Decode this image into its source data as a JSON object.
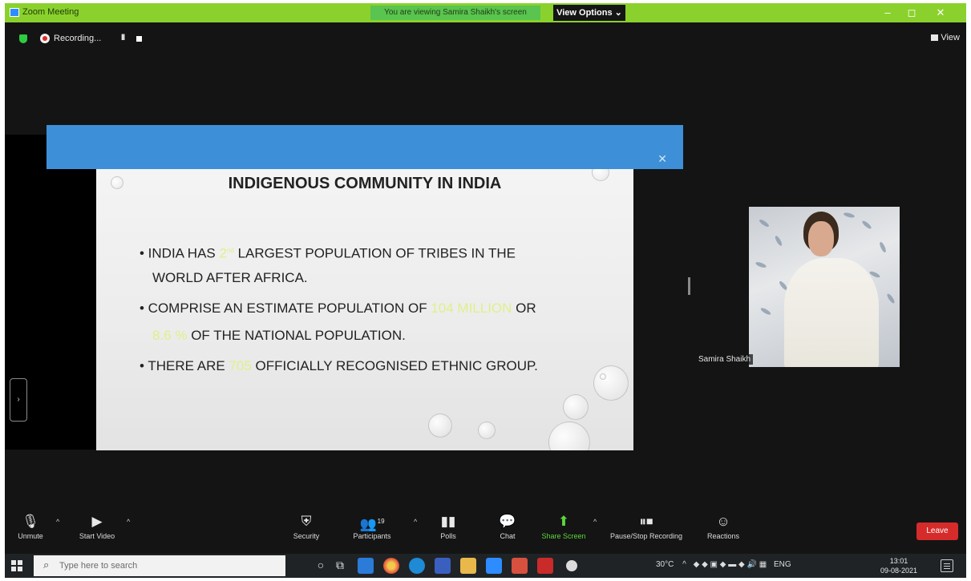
{
  "window": {
    "title": "Zoom Meeting",
    "share_banner": "You are viewing Samira Shaikh's screen",
    "view_options": "View Options",
    "view_options_caret": "⌄",
    "minimize": "–",
    "maximize": "◻",
    "close": "✕"
  },
  "recording": {
    "label": "Recording...",
    "pause_glyph": "II",
    "view_label": "View"
  },
  "slide": {
    "title": "INDIGENOUS COMMUNITY IN INDIA",
    "bullet1": {
      "prefix": "• INDIA HAS ",
      "highlight": "2",
      "superscript": "nd",
      "suffix": "  LARGEST POPULATION OF TRIBES IN THE",
      "line2": "WORLD AFTER AFRICA."
    },
    "bullet2": {
      "prefix": "• COMPRISE AN ESTIMATE  POPULATION OF ",
      "highlight": "104 MILLION",
      "suffix": " OR",
      "line2_highlight": "8.6 %",
      "line2_suffix": " OF THE NATIONAL POPULATION."
    },
    "bullet3": {
      "prefix": "• THERE ARE ",
      "highlight": "705",
      "suffix": " OFFICIALLY RECOGNISED ETHNIC GROUP."
    },
    "close_glyph": "✕"
  },
  "participant": {
    "name": "Samira Shaikh"
  },
  "side_toggle_glyph": "›",
  "controls": {
    "unmute": "Unmute",
    "start_video": "Start Video",
    "security": "Security",
    "participants": "Participants",
    "participants_count": "19",
    "polls": "Polls",
    "chat": "Chat",
    "share_screen": "Share Screen",
    "pause_stop_recording": "Pause/Stop Recording",
    "reactions": "Reactions",
    "leave": "Leave",
    "caret": "^",
    "icons": {
      "unmute": "mic-muted-icon",
      "start_video": "video-off-icon",
      "security": "shield-icon",
      "participants": "people-icon",
      "polls": "poll-icon",
      "chat": "chat-icon",
      "share_screen": "share-screen-icon",
      "pause_stop_recording": "pause-stop-icon",
      "reactions": "smiley-icon"
    }
  },
  "taskbar": {
    "search_placeholder": "Type here to search",
    "tray_weather": "30°C",
    "tray_lang": "ENG",
    "time": "13:01",
    "date": "09-08-2021",
    "tray_arrow": "^"
  },
  "colors": {
    "titlebar": "#8bd12d",
    "share_banner": "#59c44f",
    "notification_bar": "#3d90d8",
    "leave": "#d62b2b",
    "slide_highlight": "#dff08a"
  }
}
